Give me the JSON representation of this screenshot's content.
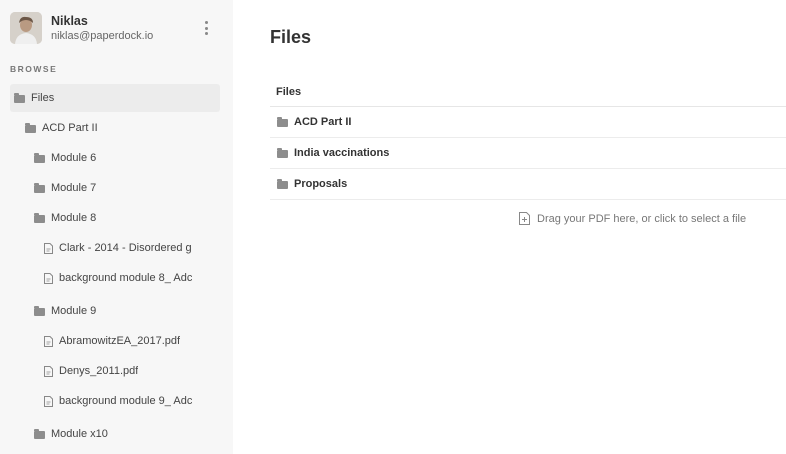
{
  "user": {
    "name": "Niklas",
    "email": "niklas@paperdock.io"
  },
  "sidebar": {
    "section_label": "BROWSE",
    "items": [
      {
        "label": "Files",
        "type": "folder"
      },
      {
        "label": "ACD Part II",
        "type": "folder"
      },
      {
        "label": "Module 6",
        "type": "folder"
      },
      {
        "label": "Module 7",
        "type": "folder"
      },
      {
        "label": "Module 8",
        "type": "folder"
      },
      {
        "label": "Clark - 2014 - Disordered g",
        "type": "file"
      },
      {
        "label": "background module 8_ Adc",
        "type": "file"
      },
      {
        "label": "Module 9",
        "type": "folder"
      },
      {
        "label": "AbramowitzEA_2017.pdf",
        "type": "file"
      },
      {
        "label": "Denys_2011.pdf",
        "type": "file"
      },
      {
        "label": "background module 9_ Adc",
        "type": "file"
      },
      {
        "label": "Module x10",
        "type": "folder"
      }
    ]
  },
  "main": {
    "title": "Files",
    "list_header": "Files",
    "rows": [
      {
        "label": "ACD Part II",
        "type": "folder"
      },
      {
        "label": "India vaccinations",
        "type": "folder"
      },
      {
        "label": "Proposals",
        "type": "folder"
      }
    ],
    "dropzone_text": "Drag your PDF here, or click to select a file"
  },
  "icons": {
    "folder": "folder-icon",
    "file": "file-icon",
    "upload": "file-upload-icon",
    "menu": "more-vertical-icon"
  }
}
